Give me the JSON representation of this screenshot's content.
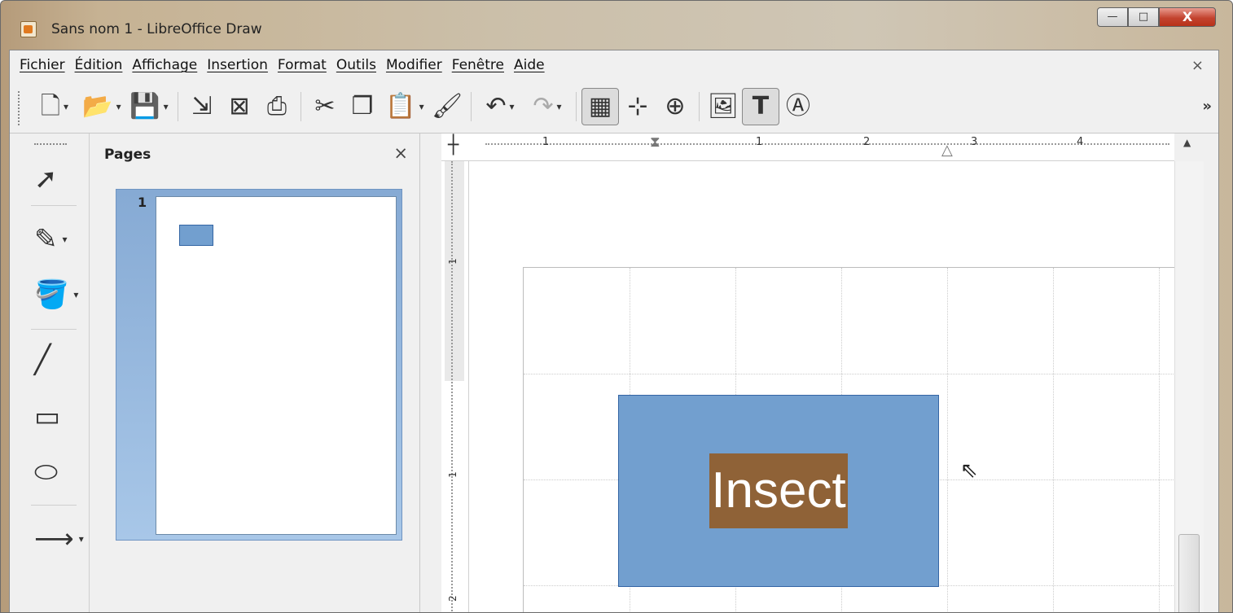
{
  "window": {
    "title": "Sans nom 1 - LibreOffice Draw",
    "minimize": "—",
    "maximize": "□",
    "close": "X"
  },
  "menu": {
    "items": [
      "Fichier",
      "Édition",
      "Affichage",
      "Insertion",
      "Format",
      "Outils",
      "Modifier",
      "Fenêtre",
      "Aide"
    ],
    "close_doc": "×"
  },
  "toolbar": {
    "more": "»"
  },
  "pages_panel": {
    "title": "Pages",
    "close": "×",
    "page_number": "1"
  },
  "ruler": {
    "top_labels": [
      "1",
      "1",
      "2",
      "3",
      "4"
    ],
    "left_labels": [
      "1",
      "1",
      "2"
    ]
  },
  "canvas": {
    "shape_text": "Insect",
    "shape_fill": "#729fcf",
    "text_highlight": "#8f6237"
  }
}
